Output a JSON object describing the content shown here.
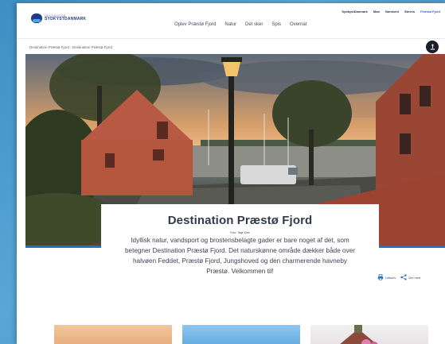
{
  "logo": {
    "line1": "DESTINATION",
    "line2": "SYDKYSTDANMARK"
  },
  "utility_nav": [
    "SydkystDanmark",
    "Møn",
    "Næstved",
    "Stevns",
    "Præstø Fjord"
  ],
  "main_nav": [
    "Oplev Præstø Fjord",
    "Natur",
    "Det sker",
    "Spis",
    "Overnat"
  ],
  "breadcrumb": "Destination Præstø Fjord › Destination Præstø Fjord",
  "hero": {
    "title": "Destination Præstø Fjord",
    "photo_credit": "Foto: Tage Klee",
    "body": "Idyllisk natur, vandsport og brostensbelagte gader er bare noget af det, som betegner Destination Præstø Fjord. Det naturskønne område dækker både over halvøen Feddet, Præstø Fjord, Jungshoved og den charmerende havneby Præstø. Velkommen til!"
  },
  "actions": {
    "print": "Udskriv",
    "share": "Del med"
  },
  "icons": [
    "share-icon",
    "print-icon",
    "share-nodes-icon"
  ],
  "colors": {
    "brand_blue": "#1f3b8a",
    "accent_blue": "#2a6fbd",
    "title_text": "#333a4a"
  }
}
